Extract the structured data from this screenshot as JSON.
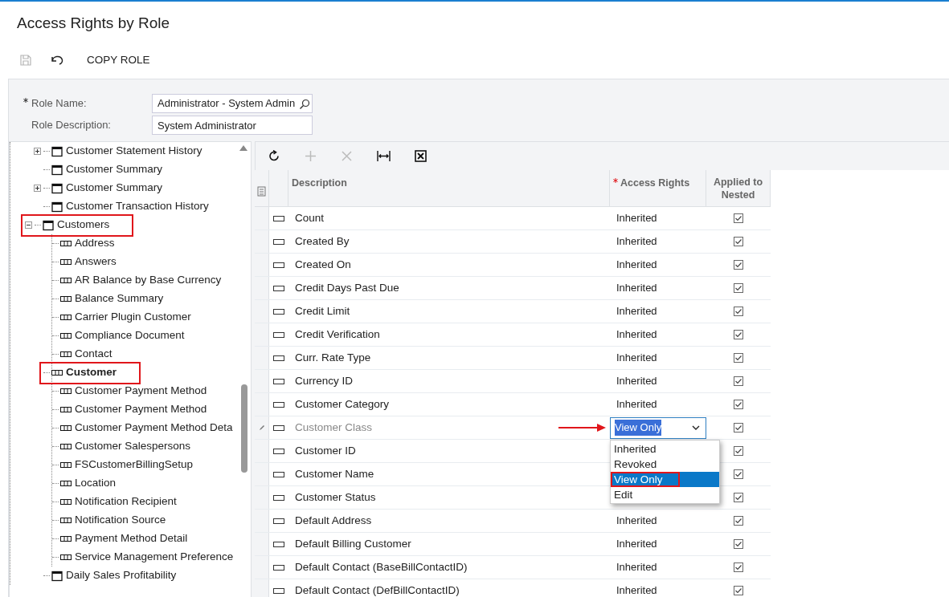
{
  "page": {
    "title": "Access Rights by Role"
  },
  "toolbar": [
    {
      "kind": "save",
      "disabled": true
    },
    {
      "kind": "undo",
      "disabled": false
    },
    {
      "kind": "text",
      "label": "COPY ROLE",
      "disabled": false
    }
  ],
  "form": {
    "fields": [
      {
        "label": "Role Name:",
        "required": true,
        "value": "Administrator - System Admin",
        "kind": "lookup"
      },
      {
        "label": "Role Description:",
        "required": false,
        "value": "System Administrator",
        "kind": "text"
      }
    ]
  },
  "tree": [
    {
      "label": "Customer Statement History",
      "kind": "screen",
      "expandable": true,
      "expanded": false,
      "selected": false,
      "annotated": false
    },
    {
      "label": "Customer Summary",
      "kind": "screen",
      "expandable": false,
      "selected": false,
      "annotated": false
    },
    {
      "label": "Customer Summary",
      "kind": "screen",
      "expandable": true,
      "expanded": false,
      "selected": false,
      "annotated": false
    },
    {
      "label": "Customer Transaction History",
      "kind": "screen",
      "expandable": false,
      "selected": false,
      "annotated": false
    },
    {
      "label": "Customers",
      "kind": "screen",
      "expandable": true,
      "expanded": true,
      "selected": false,
      "annotated": true,
      "children": [
        {
          "label": "Address",
          "kind": "table",
          "selected": false,
          "annotated": false
        },
        {
          "label": "Answers",
          "kind": "table",
          "selected": false,
          "annotated": false
        },
        {
          "label": "AR Balance by Base Currency",
          "kind": "table",
          "selected": false,
          "annotated": false
        },
        {
          "label": "Balance Summary",
          "kind": "table",
          "selected": false,
          "annotated": false
        },
        {
          "label": "Carrier Plugin Customer",
          "kind": "table",
          "selected": false,
          "annotated": false
        },
        {
          "label": "Compliance Document",
          "kind": "table",
          "selected": false,
          "annotated": false
        },
        {
          "label": "Contact",
          "kind": "table",
          "selected": false,
          "annotated": false
        },
        {
          "label": "Customer",
          "kind": "table",
          "selected": true,
          "annotated": true
        },
        {
          "label": "Customer Payment Method",
          "kind": "table",
          "selected": false,
          "annotated": false
        },
        {
          "label": "Customer Payment Method",
          "kind": "table",
          "selected": false,
          "annotated": false
        },
        {
          "label": "Customer Payment Method Deta",
          "kind": "table",
          "selected": false,
          "annotated": false
        },
        {
          "label": "Customer Salespersons",
          "kind": "table",
          "selected": false,
          "annotated": false
        },
        {
          "label": "FSCustomerBillingSetup",
          "kind": "table",
          "selected": false,
          "annotated": false
        },
        {
          "label": "Location",
          "kind": "table",
          "selected": false,
          "annotated": false
        },
        {
          "label": "Notification Recipient",
          "kind": "table",
          "selected": false,
          "annotated": false
        },
        {
          "label": "Notification Source",
          "kind": "table",
          "selected": false,
          "annotated": false
        },
        {
          "label": "Payment Method Detail",
          "kind": "table",
          "selected": false,
          "annotated": false
        },
        {
          "label": "Service Management Preference",
          "kind": "table",
          "selected": false,
          "annotated": false
        }
      ]
    },
    {
      "label": "Daily Sales Profitability",
      "kind": "screen",
      "expandable": false,
      "selected": false,
      "annotated": false
    }
  ],
  "grid": {
    "toolbar": [
      {
        "kind": "refresh",
        "disabled": false
      },
      {
        "kind": "add",
        "disabled": true
      },
      {
        "kind": "delete",
        "disabled": true
      },
      {
        "kind": "fit",
        "disabled": false
      },
      {
        "kind": "excel",
        "disabled": false
      }
    ],
    "columns": [
      {
        "label": "Description",
        "required": false
      },
      {
        "label": "Access Rights",
        "required": true
      },
      {
        "label": "Applied to Nested",
        "required": false
      }
    ],
    "rows": [
      {
        "description": "Count",
        "access": "Inherited",
        "applied": true,
        "editing": false
      },
      {
        "description": "Created By",
        "access": "Inherited",
        "applied": true,
        "editing": false
      },
      {
        "description": "Created On",
        "access": "Inherited",
        "applied": true,
        "editing": false
      },
      {
        "description": "Credit Days Past Due",
        "access": "Inherited",
        "applied": true,
        "editing": false
      },
      {
        "description": "Credit Limit",
        "access": "Inherited",
        "applied": true,
        "editing": false
      },
      {
        "description": "Credit Verification",
        "access": "Inherited",
        "applied": true,
        "editing": false
      },
      {
        "description": "Curr. Rate Type",
        "access": "Inherited",
        "applied": true,
        "editing": false
      },
      {
        "description": "Currency ID",
        "access": "Inherited",
        "applied": true,
        "editing": false
      },
      {
        "description": "Customer Category",
        "access": "Inherited",
        "applied": true,
        "editing": false
      },
      {
        "description": "Customer Class",
        "access": "View Only",
        "applied": true,
        "editing": true,
        "arrow": true,
        "options": [
          {
            "label": "Inherited",
            "selected": false,
            "annotated": false
          },
          {
            "label": "Revoked",
            "selected": false,
            "annotated": false
          },
          {
            "label": "View Only",
            "selected": true,
            "annotated": true
          },
          {
            "label": "Edit",
            "selected": false,
            "annotated": false
          }
        ]
      },
      {
        "description": "Customer ID",
        "applied": true,
        "editing": false
      },
      {
        "description": "Customer Name",
        "applied": true,
        "editing": false
      },
      {
        "description": "Customer Status",
        "applied": true,
        "editing": false
      },
      {
        "description": "Default Address",
        "access": "Inherited",
        "applied": true,
        "editing": false
      },
      {
        "description": "Default Billing Customer",
        "access": "Inherited",
        "applied": true,
        "editing": false
      },
      {
        "description": "Default Contact (BaseBillContactID)",
        "access": "Inherited",
        "applied": true,
        "editing": false
      },
      {
        "description": "Default Contact (DefBillContactID)",
        "access": "Inherited",
        "applied": true,
        "editing": false
      }
    ]
  }
}
